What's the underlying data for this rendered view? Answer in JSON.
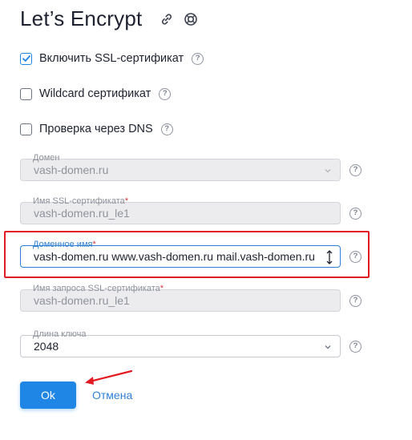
{
  "header": {
    "title": "Let’s Encrypt",
    "icons": [
      "link-icon",
      "help-ring-icon"
    ]
  },
  "options": [
    {
      "label": "Включить SSL-сертификат",
      "checked": true
    },
    {
      "label": "Wildcard сертификат",
      "checked": false
    },
    {
      "label": "Проверка через DNS",
      "checked": false
    }
  ],
  "fields": {
    "domain": {
      "label": "Домен",
      "value": "vash-domen.ru",
      "disabled": true,
      "type": "select"
    },
    "ssl_name": {
      "label": "Имя SSL-сертификата",
      "required_mark": "*",
      "value": "vash-domen.ru_le1",
      "disabled": true
    },
    "domain_names": {
      "label": "Доменное имя",
      "required_mark": "*",
      "value": "vash-domen.ru www.vash-domen.ru mail.vash-domen.ru",
      "disabled": false,
      "focused": true
    },
    "csr_name": {
      "label": "Имя запроса SSL-сертификата",
      "required_mark": "*",
      "value": "vash-domen.ru_le1",
      "disabled": true
    },
    "key_length": {
      "label": "Длина ключа",
      "value": "2048",
      "disabled": false,
      "type": "select"
    }
  },
  "help_glyph": "?",
  "buttons": {
    "ok": "Ok",
    "cancel": "Отмена"
  },
  "colors": {
    "accent": "#1f86e6",
    "highlight": "#e21b23",
    "required": "#d63845"
  }
}
